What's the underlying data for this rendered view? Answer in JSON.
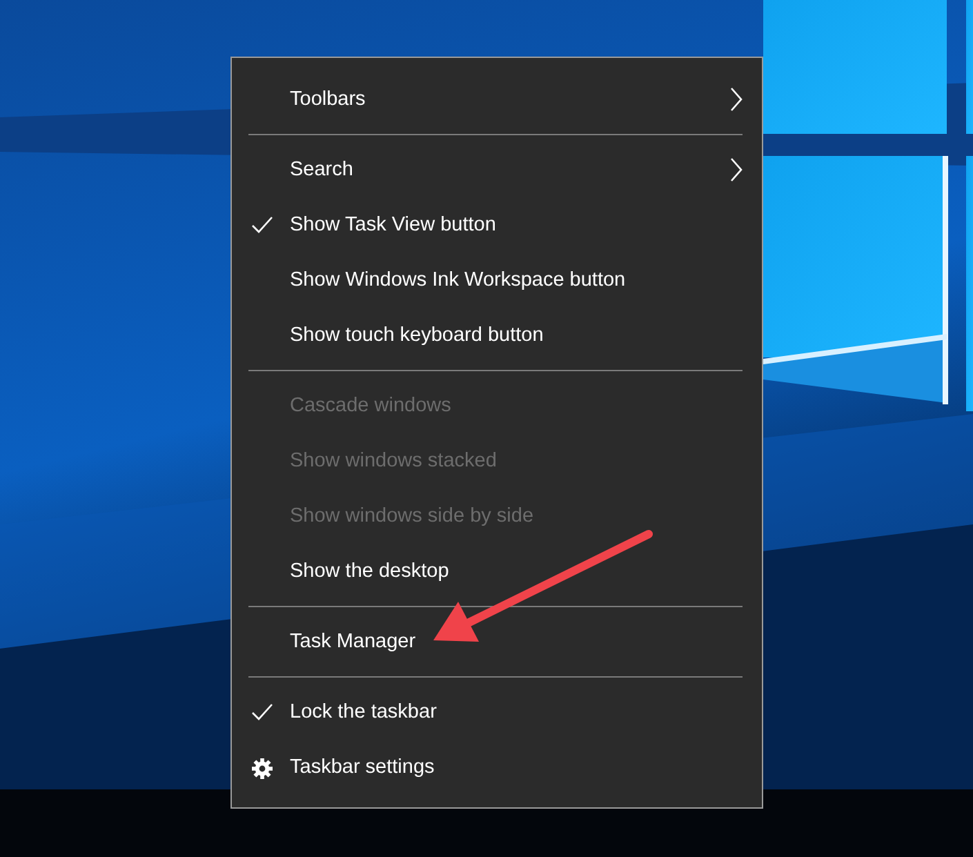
{
  "menu": {
    "sections": [
      {
        "items": [
          {
            "label": "Toolbars",
            "kind": "submenu",
            "checked": false,
            "disabled": false
          }
        ]
      },
      {
        "items": [
          {
            "label": "Search",
            "kind": "submenu",
            "checked": false,
            "disabled": false
          },
          {
            "label": "Show Task View button",
            "kind": "item",
            "checked": true,
            "disabled": false
          },
          {
            "label": "Show Windows Ink Workspace button",
            "kind": "item",
            "checked": false,
            "disabled": false
          },
          {
            "label": "Show touch keyboard button",
            "kind": "item",
            "checked": false,
            "disabled": false
          }
        ]
      },
      {
        "items": [
          {
            "label": "Cascade windows",
            "kind": "item",
            "checked": false,
            "disabled": true
          },
          {
            "label": "Show windows stacked",
            "kind": "item",
            "checked": false,
            "disabled": true
          },
          {
            "label": "Show windows side by side",
            "kind": "item",
            "checked": false,
            "disabled": true
          },
          {
            "label": "Show the desktop",
            "kind": "item",
            "checked": false,
            "disabled": false
          }
        ]
      },
      {
        "items": [
          {
            "label": "Task Manager",
            "kind": "item",
            "checked": false,
            "disabled": false
          }
        ]
      },
      {
        "items": [
          {
            "label": "Lock the taskbar",
            "kind": "item",
            "checked": true,
            "disabled": false
          },
          {
            "label": "Taskbar settings",
            "kind": "settings",
            "checked": false,
            "disabled": false
          }
        ]
      }
    ]
  }
}
